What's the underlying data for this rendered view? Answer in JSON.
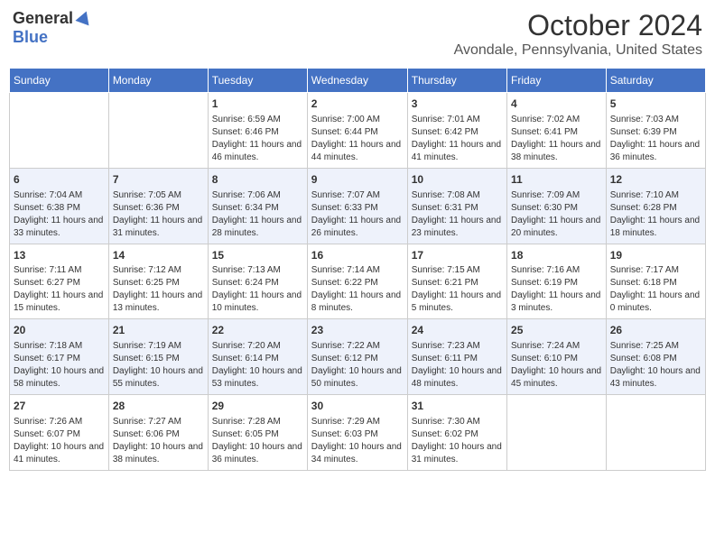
{
  "header": {
    "logo_general": "General",
    "logo_blue": "Blue",
    "month_title": "October 2024",
    "location": "Avondale, Pennsylvania, United States"
  },
  "days_of_week": [
    "Sunday",
    "Monday",
    "Tuesday",
    "Wednesday",
    "Thursday",
    "Friday",
    "Saturday"
  ],
  "weeks": [
    [
      {
        "day": "",
        "content": ""
      },
      {
        "day": "",
        "content": ""
      },
      {
        "day": "1",
        "content": "Sunrise: 6:59 AM\nSunset: 6:46 PM\nDaylight: 11 hours and 46 minutes."
      },
      {
        "day": "2",
        "content": "Sunrise: 7:00 AM\nSunset: 6:44 PM\nDaylight: 11 hours and 44 minutes."
      },
      {
        "day": "3",
        "content": "Sunrise: 7:01 AM\nSunset: 6:42 PM\nDaylight: 11 hours and 41 minutes."
      },
      {
        "day": "4",
        "content": "Sunrise: 7:02 AM\nSunset: 6:41 PM\nDaylight: 11 hours and 38 minutes."
      },
      {
        "day": "5",
        "content": "Sunrise: 7:03 AM\nSunset: 6:39 PM\nDaylight: 11 hours and 36 minutes."
      }
    ],
    [
      {
        "day": "6",
        "content": "Sunrise: 7:04 AM\nSunset: 6:38 PM\nDaylight: 11 hours and 33 minutes."
      },
      {
        "day": "7",
        "content": "Sunrise: 7:05 AM\nSunset: 6:36 PM\nDaylight: 11 hours and 31 minutes."
      },
      {
        "day": "8",
        "content": "Sunrise: 7:06 AM\nSunset: 6:34 PM\nDaylight: 11 hours and 28 minutes."
      },
      {
        "day": "9",
        "content": "Sunrise: 7:07 AM\nSunset: 6:33 PM\nDaylight: 11 hours and 26 minutes."
      },
      {
        "day": "10",
        "content": "Sunrise: 7:08 AM\nSunset: 6:31 PM\nDaylight: 11 hours and 23 minutes."
      },
      {
        "day": "11",
        "content": "Sunrise: 7:09 AM\nSunset: 6:30 PM\nDaylight: 11 hours and 20 minutes."
      },
      {
        "day": "12",
        "content": "Sunrise: 7:10 AM\nSunset: 6:28 PM\nDaylight: 11 hours and 18 minutes."
      }
    ],
    [
      {
        "day": "13",
        "content": "Sunrise: 7:11 AM\nSunset: 6:27 PM\nDaylight: 11 hours and 15 minutes."
      },
      {
        "day": "14",
        "content": "Sunrise: 7:12 AM\nSunset: 6:25 PM\nDaylight: 11 hours and 13 minutes."
      },
      {
        "day": "15",
        "content": "Sunrise: 7:13 AM\nSunset: 6:24 PM\nDaylight: 11 hours and 10 minutes."
      },
      {
        "day": "16",
        "content": "Sunrise: 7:14 AM\nSunset: 6:22 PM\nDaylight: 11 hours and 8 minutes."
      },
      {
        "day": "17",
        "content": "Sunrise: 7:15 AM\nSunset: 6:21 PM\nDaylight: 11 hours and 5 minutes."
      },
      {
        "day": "18",
        "content": "Sunrise: 7:16 AM\nSunset: 6:19 PM\nDaylight: 11 hours and 3 minutes."
      },
      {
        "day": "19",
        "content": "Sunrise: 7:17 AM\nSunset: 6:18 PM\nDaylight: 11 hours and 0 minutes."
      }
    ],
    [
      {
        "day": "20",
        "content": "Sunrise: 7:18 AM\nSunset: 6:17 PM\nDaylight: 10 hours and 58 minutes."
      },
      {
        "day": "21",
        "content": "Sunrise: 7:19 AM\nSunset: 6:15 PM\nDaylight: 10 hours and 55 minutes."
      },
      {
        "day": "22",
        "content": "Sunrise: 7:20 AM\nSunset: 6:14 PM\nDaylight: 10 hours and 53 minutes."
      },
      {
        "day": "23",
        "content": "Sunrise: 7:22 AM\nSunset: 6:12 PM\nDaylight: 10 hours and 50 minutes."
      },
      {
        "day": "24",
        "content": "Sunrise: 7:23 AM\nSunset: 6:11 PM\nDaylight: 10 hours and 48 minutes."
      },
      {
        "day": "25",
        "content": "Sunrise: 7:24 AM\nSunset: 6:10 PM\nDaylight: 10 hours and 45 minutes."
      },
      {
        "day": "26",
        "content": "Sunrise: 7:25 AM\nSunset: 6:08 PM\nDaylight: 10 hours and 43 minutes."
      }
    ],
    [
      {
        "day": "27",
        "content": "Sunrise: 7:26 AM\nSunset: 6:07 PM\nDaylight: 10 hours and 41 minutes."
      },
      {
        "day": "28",
        "content": "Sunrise: 7:27 AM\nSunset: 6:06 PM\nDaylight: 10 hours and 38 minutes."
      },
      {
        "day": "29",
        "content": "Sunrise: 7:28 AM\nSunset: 6:05 PM\nDaylight: 10 hours and 36 minutes."
      },
      {
        "day": "30",
        "content": "Sunrise: 7:29 AM\nSunset: 6:03 PM\nDaylight: 10 hours and 34 minutes."
      },
      {
        "day": "31",
        "content": "Sunrise: 7:30 AM\nSunset: 6:02 PM\nDaylight: 10 hours and 31 minutes."
      },
      {
        "day": "",
        "content": ""
      },
      {
        "day": "",
        "content": ""
      }
    ]
  ]
}
